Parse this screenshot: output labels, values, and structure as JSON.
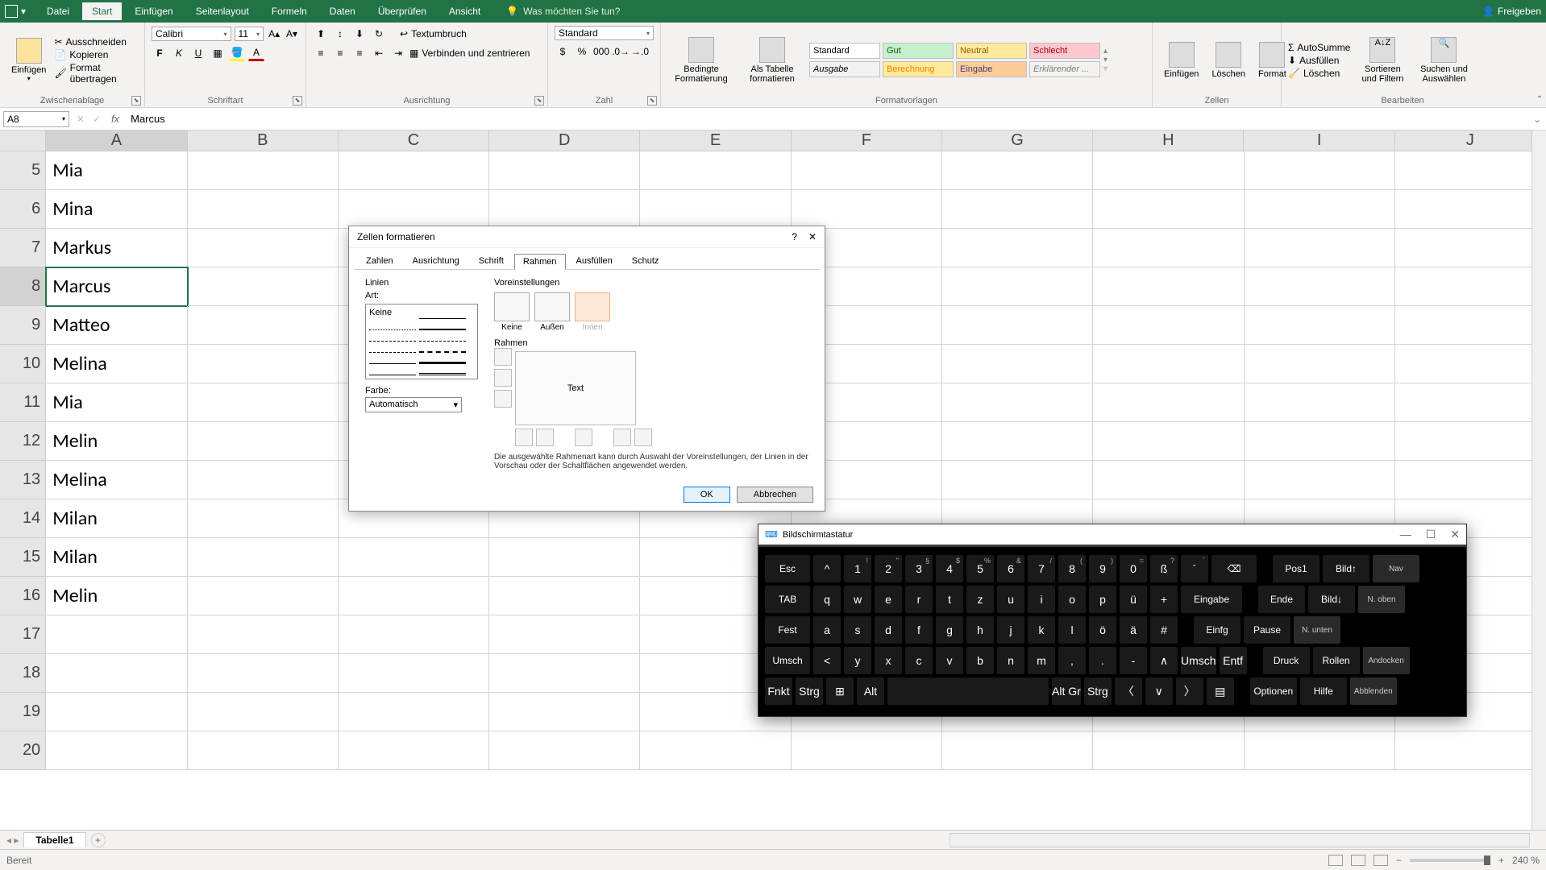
{
  "titlebar": {
    "tabs": [
      "Datei",
      "Start",
      "Einfügen",
      "Seitenlayout",
      "Formeln",
      "Daten",
      "Überprüfen",
      "Ansicht"
    ],
    "active_tab": "Start",
    "tell_me": "Was möchten Sie tun?",
    "share": "Freigeben"
  },
  "ribbon": {
    "clipboard": {
      "label": "Zwischenablage",
      "paste": "Einfügen",
      "cut": "Ausschneiden",
      "copy": "Kopieren",
      "format_painter": "Format übertragen"
    },
    "font": {
      "label": "Schriftart",
      "name": "Calibri",
      "size": "11"
    },
    "alignment": {
      "label": "Ausrichtung",
      "wrap": "Textumbruch",
      "merge": "Verbinden und zentrieren"
    },
    "number": {
      "label": "Zahl",
      "format": "Standard"
    },
    "styles": {
      "label": "Formatvorlagen",
      "cond": "Bedingte Formatierung",
      "table": "Als Tabelle formatieren",
      "cells": [
        "Standard",
        "Gut",
        "Neutral",
        "Schlecht",
        "Ausgabe",
        "Berechnung",
        "Eingabe",
        "Erklärender ..."
      ]
    },
    "cells_grp": {
      "label": "Zellen",
      "insert": "Einfügen",
      "delete": "Löschen",
      "format": "Format"
    },
    "editing": {
      "label": "Bearbeiten",
      "autosum": "AutoSumme",
      "fill": "Ausfüllen",
      "clear": "Löschen",
      "sort": "Sortieren und Filtern",
      "find": "Suchen und Auswählen"
    }
  },
  "namebox": "A8",
  "formula": "Marcus",
  "columns": [
    "A",
    "B",
    "C",
    "D",
    "E",
    "F",
    "G",
    "H",
    "I",
    "J"
  ],
  "rows": [
    {
      "n": 5,
      "a": "Mia"
    },
    {
      "n": 6,
      "a": "Mina"
    },
    {
      "n": 7,
      "a": "Markus"
    },
    {
      "n": 8,
      "a": "Marcus"
    },
    {
      "n": 9,
      "a": "Matteo"
    },
    {
      "n": 10,
      "a": "Melina"
    },
    {
      "n": 11,
      "a": "Mia"
    },
    {
      "n": 12,
      "a": "Melin"
    },
    {
      "n": 13,
      "a": "Melina"
    },
    {
      "n": 14,
      "a": "Milan"
    },
    {
      "n": 15,
      "a": "Milan"
    },
    {
      "n": 16,
      "a": "Melin"
    },
    {
      "n": 17,
      "a": ""
    },
    {
      "n": 18,
      "a": ""
    },
    {
      "n": 19,
      "a": ""
    },
    {
      "n": 20,
      "a": ""
    }
  ],
  "sheet_tab": "Tabelle1",
  "status": {
    "ready": "Bereit",
    "zoom": "240 %"
  },
  "dialog": {
    "title": "Zellen formatieren",
    "tabs": [
      "Zahlen",
      "Ausrichtung",
      "Schrift",
      "Rahmen",
      "Ausfüllen",
      "Schutz"
    ],
    "active": "Rahmen",
    "linien": "Linien",
    "art": "Art:",
    "keine": "Keine",
    "farbe": "Farbe:",
    "auto": "Automatisch",
    "voreinst": "Voreinstellungen",
    "presets": [
      "Keine",
      "Außen",
      "Innen"
    ],
    "rahmen": "Rahmen",
    "text": "Text",
    "hint": "Die ausgewählte Rahmenart kann durch Auswahl der Voreinstellungen, der Linien in der Vorschau oder der Schaltflächen angewendet werden.",
    "ok": "OK",
    "cancel": "Abbrechen"
  },
  "osk": {
    "title": "Bildschirmtastatur",
    "row1": [
      "Esc",
      "^",
      "1",
      "2",
      "3",
      "4",
      "5",
      "6",
      "7",
      "8",
      "9",
      "0",
      "ß",
      "´",
      "⌫"
    ],
    "row1_sup": [
      "",
      "",
      "!",
      "\"",
      "§",
      "$",
      "%",
      "&",
      "/",
      "(",
      ")",
      "=",
      "?",
      "`",
      ""
    ],
    "row2": [
      "TAB",
      "q",
      "w",
      "e",
      "r",
      "t",
      "z",
      "u",
      "i",
      "o",
      "p",
      "ü",
      "+",
      "Eingabe"
    ],
    "row3": [
      "Fest",
      "a",
      "s",
      "d",
      "f",
      "g",
      "h",
      "j",
      "k",
      "l",
      "ö",
      "ä",
      "#"
    ],
    "row4": [
      "Umsch",
      "<",
      "y",
      "x",
      "c",
      "v",
      "b",
      "n",
      "m",
      ",",
      ".",
      "-",
      "∧",
      "Umsch",
      "Entf"
    ],
    "row5": [
      "Fnkt",
      "Strg",
      "⊞",
      "Alt",
      " ",
      "Alt Gr",
      "Strg",
      "〈",
      "∨",
      "〉",
      "▤"
    ],
    "side1": [
      "Pos1",
      "Bild↑",
      "Nav"
    ],
    "side2": [
      "Ende",
      "Bild↓",
      "N. oben"
    ],
    "side3": [
      "Einfg",
      "Pause",
      "N. unten"
    ],
    "side4": [
      "Druck",
      "Rollen",
      "Andocken"
    ],
    "side5": [
      "Optionen",
      "Hilfe",
      "Abblenden"
    ]
  }
}
